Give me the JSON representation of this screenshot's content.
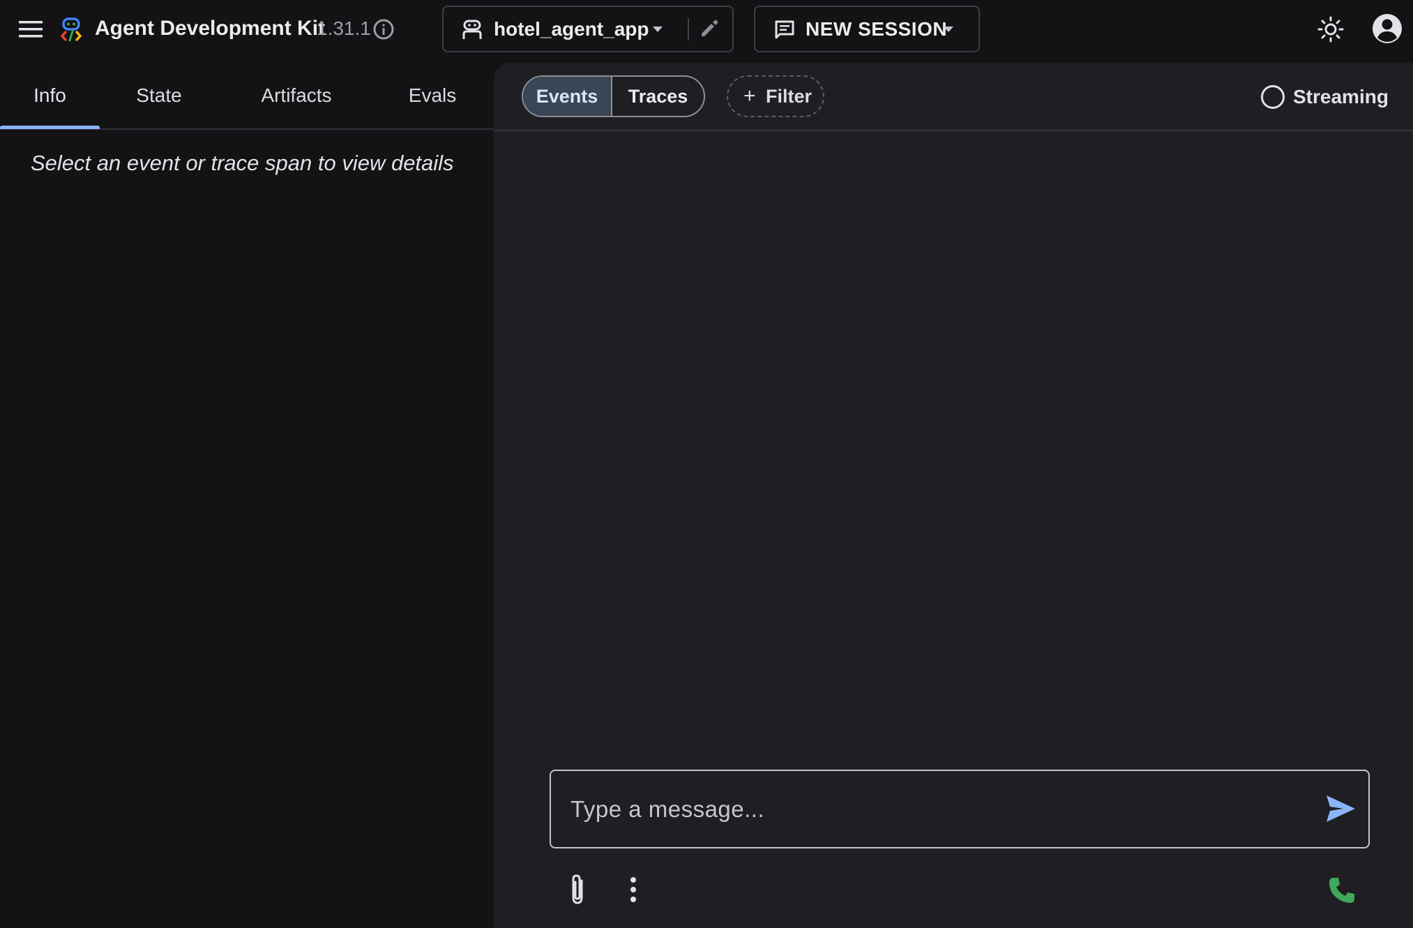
{
  "header": {
    "title": "Agent Development Kit",
    "version": "1.31.1",
    "app_name": "hotel_agent_app",
    "session_label": "NEW SESSION"
  },
  "left_panel": {
    "tabs": [
      {
        "label": "Info",
        "active": true
      },
      {
        "label": "State",
        "active": false
      },
      {
        "label": "Artifacts",
        "active": false
      },
      {
        "label": "Evals",
        "active": false
      }
    ],
    "empty_message": "Select an event or trace span to view details"
  },
  "right_panel": {
    "toggle": [
      {
        "label": "Events",
        "selected": true
      },
      {
        "label": "Traces",
        "selected": false
      }
    ],
    "filter_label": "Filter",
    "streaming_label": "Streaming",
    "message_placeholder": "Type a message..."
  },
  "icons": {
    "menu": "menu-icon",
    "logo": "adk-logo-icon",
    "info": "info-icon",
    "robot": "robot-icon",
    "edit": "pencil-icon",
    "chat": "chat-icon",
    "theme": "sun-icon",
    "avatar": "account-circle-icon",
    "send": "send-icon",
    "attach": "paperclip-icon",
    "more": "more-vert-icon",
    "call": "phone-icon"
  },
  "colors": {
    "accent": "#8ab4f8",
    "call_green": "#3fa85a",
    "background": "#131215",
    "panel": "#1f1e22"
  }
}
